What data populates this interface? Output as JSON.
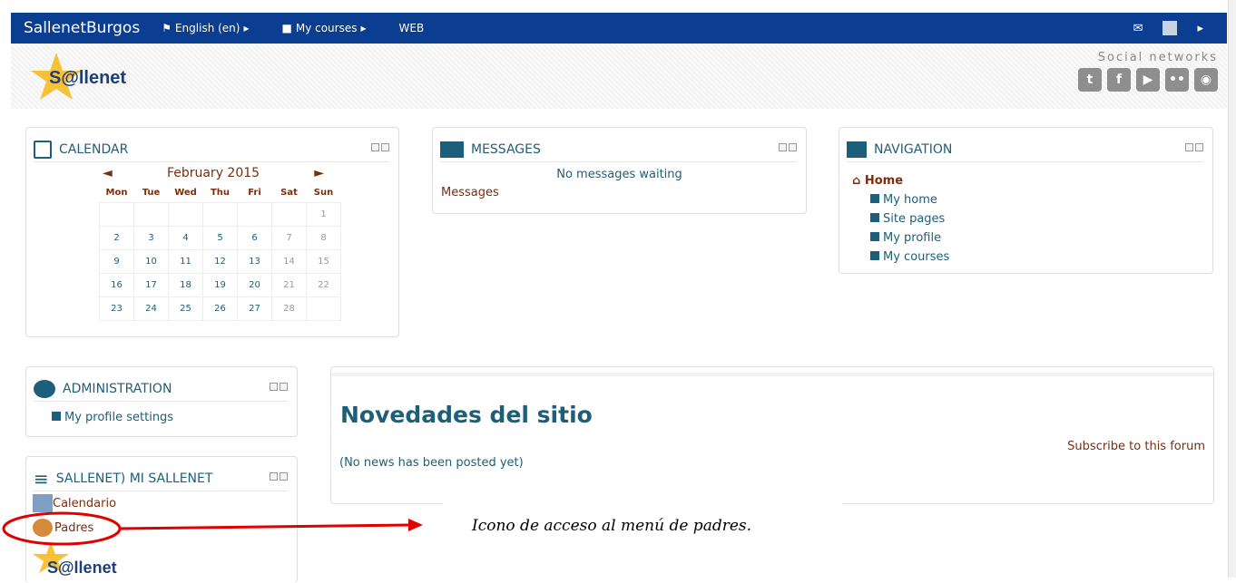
{
  "navbar": {
    "brand": "SallenetBurgos",
    "language": "English (en)",
    "my_courses": "My courses",
    "web": "WEB",
    "bg_color": "#0b3d91"
  },
  "header": {
    "logo_text": "S@llenet",
    "social_title": "Social networks",
    "social_icons": [
      "twitter-icon",
      "facebook-icon",
      "youtube-icon",
      "flickr-icon",
      "blog-icon"
    ]
  },
  "calendar": {
    "title": "CALENDAR",
    "month": "February 2015",
    "prev": "◄",
    "next": "►",
    "days": [
      "Mon",
      "Tue",
      "Wed",
      "Thu",
      "Fri",
      "Sat",
      "Sun"
    ],
    "weeks": [
      [
        "",
        "",
        "",
        "",
        "",
        "",
        "1"
      ],
      [
        "2",
        "3",
        "4",
        "5",
        "6",
        "7",
        "8"
      ],
      [
        "9",
        "10",
        "11",
        "12",
        "13",
        "14",
        "15"
      ],
      [
        "16",
        "17",
        "18",
        "19",
        "20",
        "21",
        "22"
      ],
      [
        "23",
        "24",
        "25",
        "26",
        "27",
        "28",
        ""
      ]
    ]
  },
  "messages": {
    "title": "MESSAGES",
    "status": "No messages waiting",
    "link": "Messages"
  },
  "navigation": {
    "title": "NAVIGATION",
    "home": "Home",
    "items": [
      "My home",
      "Site pages",
      "My profile",
      "My courses"
    ]
  },
  "administration": {
    "title": "ADMINISTRATION",
    "item": "My profile settings"
  },
  "sallenet_block": {
    "title": "SALLENET) MI SALLENET",
    "items": [
      "Calendario",
      "Padres"
    ]
  },
  "news": {
    "title": "Novedades del sitio",
    "subscribe": "Subscribe to this forum",
    "empty": "(No news has been posted yet)"
  },
  "annotation": {
    "text": "Icono de acceso al menú de padres.",
    "color": "#e00000"
  }
}
